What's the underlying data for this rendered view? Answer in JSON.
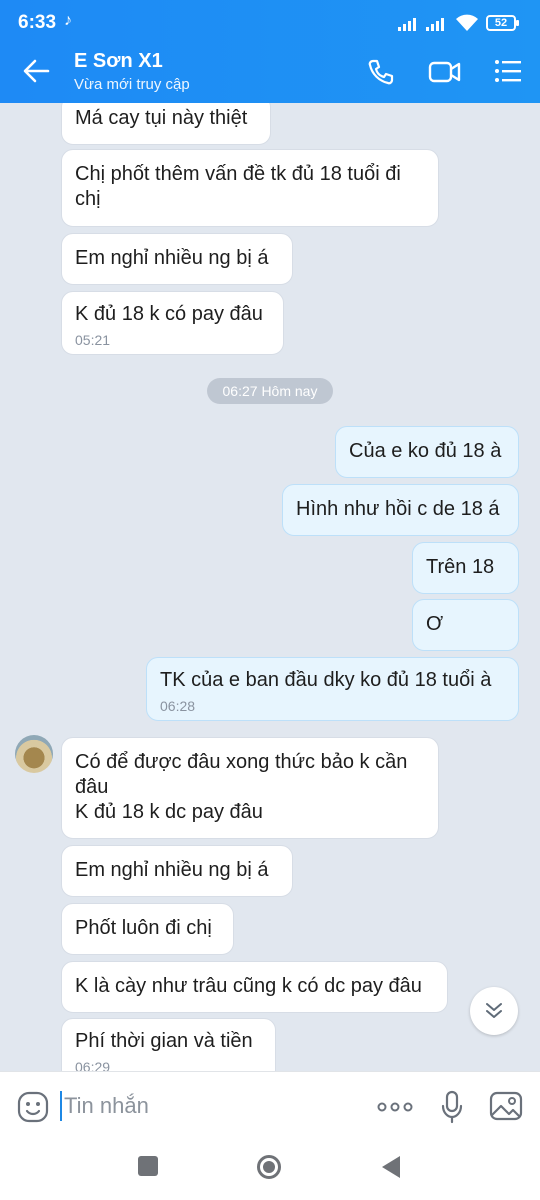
{
  "status": {
    "time": "6:33",
    "battery": "52"
  },
  "header": {
    "title": "E Sơn X1",
    "subtitle": "Vừa mới truy cập"
  },
  "messages": [
    {
      "text": "Má cay tụi này thiệt"
    },
    {
      "text": "Chị phốt thêm vấn đề tk đủ 18 tuổi đi chị"
    },
    {
      "text": "Em nghỉ nhiều ng bị á"
    },
    {
      "text": "K đủ 18 k có pay đâu",
      "time": "05:21"
    },
    {
      "text": "Của e ko đủ 18 à"
    },
    {
      "text": "Hình như hồi c de 18 á"
    },
    {
      "text": "Trên 18"
    },
    {
      "text": "Ơ"
    },
    {
      "text": "TK của e ban đầu dky ko đủ 18 tuổi à",
      "time": "06:28"
    },
    {
      "text": "Có để được đâu xong thức bảo k cần đâu",
      "text2": "K đủ 18 k dc pay đâu"
    },
    {
      "text": "Em nghỉ nhiều ng bị á"
    },
    {
      "text": "Phốt luôn đi chị"
    },
    {
      "text": "K là cày như trâu cũng k có dc pay đâu"
    },
    {
      "text": "Phí thời gian và tiền",
      "time": "06:29"
    }
  ],
  "date_separator": "06:27 Hôm nay",
  "input": {
    "placeholder": "Tin nhắn"
  },
  "icons": [
    "back-arrow-icon",
    "phone-icon",
    "video-call-icon",
    "menu-icon",
    "emoji-icon",
    "more-icon",
    "microphone-icon",
    "image-icon",
    "scroll-down-icon"
  ],
  "colors": {
    "header": "#1e8af5",
    "chat_bg": "#e1e7ef",
    "outgoing_bubble": "#e7f5fe"
  }
}
